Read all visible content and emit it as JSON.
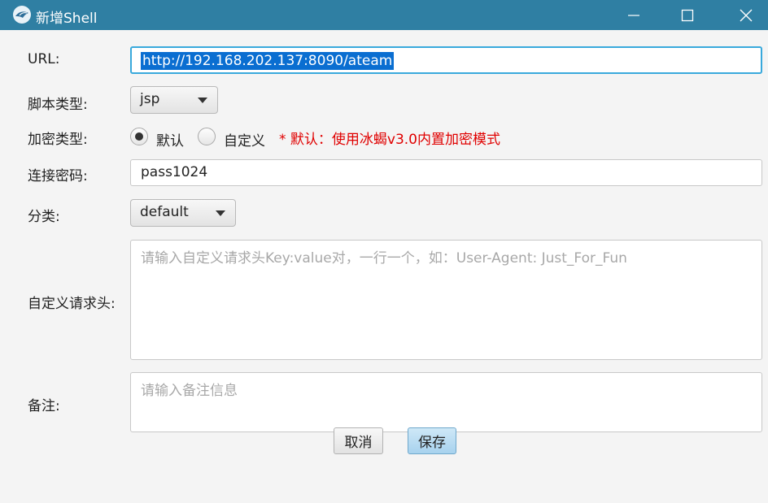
{
  "window": {
    "title": "新增Shell",
    "icons": {
      "app": "app-logo-icon",
      "minimize": "minimize-icon",
      "maximize": "maximize-icon",
      "close": "close-icon"
    }
  },
  "form": {
    "url": {
      "label": "URL:",
      "value": "http://192.168.202.137:8090/ateam"
    },
    "script_type": {
      "label": "脚本类型:",
      "value": "jsp"
    },
    "encryption": {
      "label": "加密类型:",
      "options": [
        "默认",
        "自定义"
      ],
      "selected": "默认",
      "note": "* 默认：使用冰蝎v3.0内置加密模式"
    },
    "password": {
      "label": "连接密码:",
      "value": "pass1024"
    },
    "category": {
      "label": "分类:",
      "value": "default"
    },
    "headers": {
      "label": "自定义请求头:",
      "placeholder": "请输入自定义请求头Key:value对，一行一个，如：User-Agent: Just_For_Fun"
    },
    "remark": {
      "label": "备注:",
      "placeholder": "请输入备注信息"
    }
  },
  "buttons": {
    "cancel": "取消",
    "save": "保存"
  },
  "colors": {
    "titlebar": "#2f7fa3",
    "accent_note": "#e00000",
    "selection": "#0a6ed1",
    "focus_border": "#39a9dc"
  }
}
